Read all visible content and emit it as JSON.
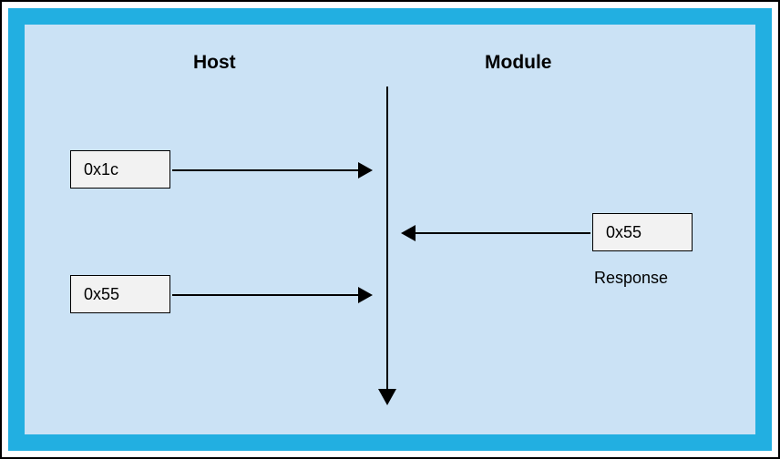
{
  "headings": {
    "host": "Host",
    "module": "Module"
  },
  "host_messages": {
    "first": "0x1c",
    "second": "0x55"
  },
  "module_messages": {
    "first": "0x55"
  },
  "labels": {
    "response": "Response"
  },
  "chart_data": {
    "type": "sequence",
    "participants": [
      "Host",
      "Module"
    ],
    "messages": [
      {
        "from": "Host",
        "to": "Module",
        "value": "0x1c"
      },
      {
        "from": "Module",
        "to": "Host",
        "value": "0x55",
        "note": "Response"
      },
      {
        "from": "Host",
        "to": "Module",
        "value": "0x55"
      }
    ]
  }
}
